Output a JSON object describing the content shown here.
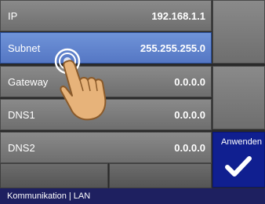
{
  "fields": [
    {
      "label": "IP",
      "value": "192.168.1.1"
    },
    {
      "label": "Subnet",
      "value": "255.255.255.0"
    },
    {
      "label": "Gateway",
      "value": "0.0.0.0"
    },
    {
      "label": "DNS1",
      "value": "0.0.0.0"
    },
    {
      "label": "DNS2",
      "value": "0.0.0.0"
    }
  ],
  "apply_button": {
    "label": "Anwenden",
    "icon": "checkmark-icon"
  },
  "status_bar": {
    "text": "Kommunikation | LAN"
  },
  "colors": {
    "active_row": "#5f82cc",
    "apply": "#101f90",
    "status": "#1e2060"
  }
}
